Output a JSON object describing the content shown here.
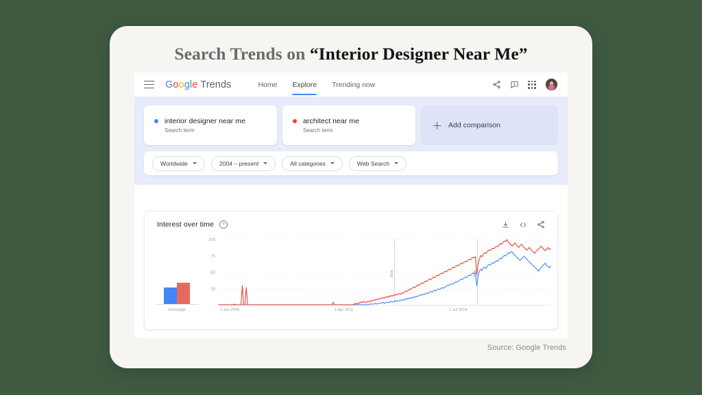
{
  "headline": {
    "gray_part": "Search Trends on ",
    "dark_part": "“Interior Designer Near Me”"
  },
  "source_note": "Source: Google Trends",
  "app": {
    "brand": {
      "g": "G",
      "o1": "o",
      "o2": "o",
      "g2": "g",
      "l": "l",
      "e": "e",
      "product": " Trends"
    },
    "nav": [
      {
        "label": "Home",
        "active": false
      },
      {
        "label": "Explore",
        "active": true
      },
      {
        "label": "Trending now",
        "active": false
      }
    ],
    "nav_icons": [
      "share-icon",
      "feedback-icon",
      "apps-grid-icon",
      "avatar"
    ],
    "menu_icon": "hamburger-icon"
  },
  "comparison": {
    "terms": [
      {
        "label": "interior designer near me",
        "sub": "Search term",
        "color": "#4285F4"
      },
      {
        "label": "architect near me",
        "sub": "Search term",
        "color": "#EA4335"
      }
    ],
    "add_label": "Add comparison"
  },
  "filters": [
    {
      "label": "Worldwide"
    },
    {
      "label": "2004 – present"
    },
    {
      "label": "All categories"
    },
    {
      "label": "Web Search"
    }
  ],
  "chart_card": {
    "title": "Interest over time",
    "help": "?",
    "tools": [
      "download-icon",
      "embed-code-icon",
      "share-icon"
    ],
    "average_label": "Average"
  },
  "chart_data": {
    "type": "line",
    "title": "Interest over time",
    "xlabel": "",
    "ylabel": "",
    "ylim": [
      0,
      100
    ],
    "yticks": [
      25,
      50,
      75,
      100
    ],
    "grid": true,
    "legend_position": "cards-above-chart",
    "xtick_labels": [
      "1 Jan 2004",
      "1 Apr 2011",
      "1 Jul 2018"
    ],
    "xtick_positions": [
      0,
      0.345,
      0.69
    ],
    "annotations": [
      {
        "text": "Note",
        "x": 0.53,
        "orientation": "vertical"
      },
      {
        "text": "Note",
        "x": 0.78,
        "orientation": "vertical"
      }
    ],
    "average_bars": {
      "categories": [
        "interior designer near me",
        "architect near me"
      ],
      "values": [
        20,
        26
      ],
      "colors": [
        "#4285F4",
        "#E8685D"
      ]
    },
    "series": [
      {
        "name": "interior designer near me",
        "color": "#4285F4",
        "values": [
          1,
          1,
          1,
          1,
          1,
          1,
          1,
          1,
          1,
          1,
          1,
          1,
          2,
          1,
          1,
          1,
          1,
          1,
          1,
          1,
          1,
          1,
          1,
          1,
          1,
          1,
          1,
          1,
          1,
          1,
          1,
          1,
          1,
          1,
          1,
          1,
          1,
          1,
          1,
          1,
          1,
          1,
          1,
          1,
          1,
          1,
          1,
          1,
          1,
          1,
          1,
          1,
          1,
          1,
          1,
          1,
          1,
          1,
          1,
          1,
          1,
          1,
          1,
          1,
          1,
          1,
          1,
          1,
          1,
          1,
          1,
          1,
          1,
          1,
          1,
          1,
          1,
          1,
          1,
          1,
          1,
          1,
          1,
          1,
          1,
          1,
          1,
          5,
          1,
          1,
          1,
          1,
          1,
          1,
          1,
          1,
          1,
          1,
          1,
          1,
          1,
          1,
          1,
          1,
          1,
          1,
          1,
          1,
          1,
          1,
          1,
          1,
          1,
          1,
          1,
          2,
          2,
          2,
          2,
          3,
          2,
          3,
          3,
          3,
          4,
          4,
          3,
          4,
          5,
          4,
          5,
          6,
          5,
          6,
          6,
          7,
          6,
          7,
          8,
          7,
          9,
          8,
          10,
          9,
          11,
          10,
          12,
          11,
          13,
          12,
          14,
          13,
          15,
          16,
          15,
          17,
          16,
          18,
          19,
          18,
          20,
          21,
          20,
          22,
          23,
          22,
          24,
          25,
          24,
          26,
          27,
          26,
          28,
          29,
          31,
          30,
          32,
          33,
          32,
          34,
          36,
          35,
          37,
          38,
          40,
          39,
          41,
          43,
          42,
          44,
          46,
          45,
          47,
          49,
          48,
          50,
          30,
          45,
          52,
          55,
          53,
          57,
          58,
          56,
          60,
          62,
          61,
          63,
          65,
          64,
          66,
          68,
          67,
          70,
          72,
          71,
          74,
          76,
          75,
          78,
          80,
          79,
          82,
          81,
          78,
          76,
          74,
          72,
          70,
          68,
          71,
          73,
          75,
          72,
          70,
          68,
          66,
          64,
          62,
          60,
          58,
          56,
          54,
          52,
          55,
          58,
          60,
          62,
          64,
          61,
          59,
          57,
          60
        ]
      },
      {
        "name": "architect near me",
        "color": "#EA4335",
        "values": [
          1,
          1,
          1,
          1,
          1,
          1,
          1,
          1,
          1,
          1,
          1,
          1,
          1,
          1,
          1,
          1,
          1,
          1,
          30,
          1,
          1,
          27,
          1,
          1,
          1,
          1,
          1,
          1,
          1,
          1,
          1,
          1,
          1,
          1,
          1,
          1,
          1,
          1,
          1,
          1,
          1,
          1,
          1,
          1,
          1,
          1,
          1,
          1,
          1,
          1,
          1,
          1,
          1,
          1,
          1,
          1,
          1,
          1,
          1,
          1,
          1,
          1,
          1,
          1,
          1,
          1,
          1,
          1,
          1,
          1,
          1,
          1,
          1,
          1,
          1,
          1,
          1,
          1,
          1,
          1,
          1,
          1,
          1,
          1,
          1,
          1,
          1,
          1,
          1,
          1,
          1,
          1,
          1,
          1,
          1,
          1,
          1,
          1,
          1,
          1,
          1,
          1,
          1,
          2,
          3,
          2,
          4,
          3,
          5,
          4,
          6,
          5,
          4,
          6,
          5,
          7,
          6,
          8,
          7,
          9,
          8,
          10,
          9,
          11,
          10,
          12,
          11,
          13,
          12,
          14,
          13,
          15,
          14,
          16,
          15,
          17,
          16,
          18,
          17,
          19,
          18,
          20,
          22,
          21,
          23,
          25,
          24,
          26,
          28,
          27,
          29,
          31,
          30,
          32,
          34,
          33,
          35,
          37,
          36,
          38,
          40,
          39,
          41,
          43,
          42,
          44,
          46,
          45,
          47,
          49,
          48,
          50,
          52,
          51,
          53,
          55,
          54,
          56,
          58,
          57,
          59,
          61,
          60,
          62,
          64,
          63,
          65,
          67,
          66,
          68,
          70,
          69,
          71,
          73,
          72,
          74,
          47,
          63,
          70,
          76,
          74,
          78,
          80,
          79,
          82,
          84,
          83,
          85,
          87,
          86,
          88,
          90,
          89,
          92,
          94,
          93,
          96,
          98,
          97,
          100,
          96,
          94,
          92,
          90,
          93,
          95,
          92,
          90,
          88,
          91,
          93,
          90,
          88,
          86,
          84,
          86,
          88,
          85,
          83,
          81,
          79,
          82,
          84,
          86,
          88,
          90,
          87,
          85,
          83,
          86,
          88,
          85,
          86
        ]
      }
    ]
  }
}
